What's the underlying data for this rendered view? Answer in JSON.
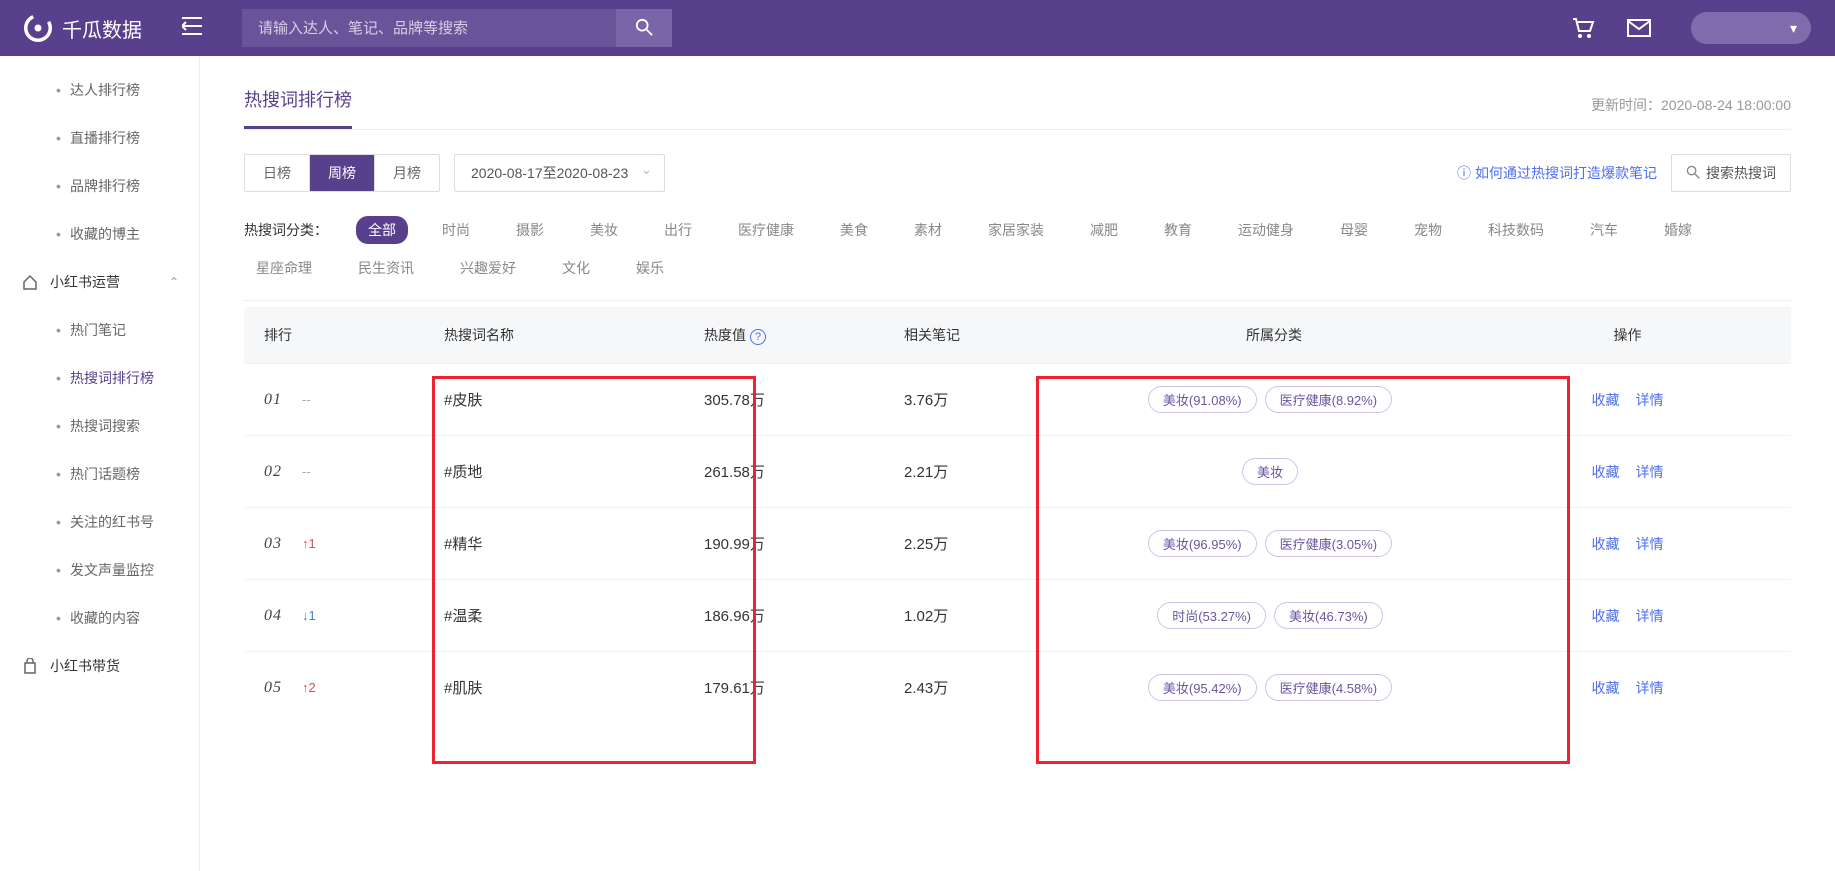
{
  "brand": "千瓜数据",
  "search_placeholder": "请输入达人、笔记、品牌等搜索",
  "sidebar": {
    "top_items": [
      "达人排行榜",
      "直播排行榜",
      "品牌排行榜",
      "收藏的博主"
    ],
    "group1": {
      "label": "小红书运营",
      "expanded": true
    },
    "sub_items": [
      "热门笔记",
      "热搜词排行榜",
      "热搜词搜索",
      "热门话题榜",
      "关注的红书号",
      "发文声量监控",
      "收藏的内容"
    ],
    "active_sub": "热搜词排行榜",
    "group2": {
      "label": "小红书带货"
    }
  },
  "page": {
    "title": "热搜词排行榜",
    "update_label": "更新时间：",
    "update_time": "2020-08-24 18:00:00"
  },
  "segments": {
    "items": [
      "日榜",
      "周榜",
      "月榜"
    ],
    "active": "周榜"
  },
  "date_range": "2020-08-17至2020-08-23",
  "help_link": "如何通过热搜词打造爆款笔记",
  "mini_search_label": "搜索热搜词",
  "categories": {
    "label": "热搜词分类：",
    "active": "全部",
    "items": [
      "全部",
      "时尚",
      "摄影",
      "美妆",
      "出行",
      "医疗健康",
      "美食",
      "素材",
      "家居家装",
      "减肥",
      "教育",
      "运动健身",
      "母婴",
      "宠物",
      "科技数码",
      "汽车",
      "婚嫁",
      "星座命理",
      "民生资讯",
      "兴趣爱好",
      "文化",
      "娱乐"
    ]
  },
  "table": {
    "headers": {
      "rank": "排行",
      "name": "热搜词名称",
      "heat": "热度值",
      "notes": "相关笔记",
      "cat": "所属分类",
      "op": "操作"
    },
    "op_labels": {
      "fav": "收藏",
      "detail": "详情"
    },
    "rows": [
      {
        "rank": "01",
        "trend": "--",
        "trend_dir": "flat",
        "name": "#皮肤",
        "heat": "305.78万",
        "notes": "3.76万",
        "cats": [
          "美妆(91.08%)",
          "医疗健康(8.92%)"
        ]
      },
      {
        "rank": "02",
        "trend": "--",
        "trend_dir": "flat",
        "name": "#质地",
        "heat": "261.58万",
        "notes": "2.21万",
        "cats": [
          "美妆"
        ]
      },
      {
        "rank": "03",
        "trend": "↑1",
        "trend_dir": "up",
        "name": "#精华",
        "heat": "190.99万",
        "notes": "2.25万",
        "cats": [
          "美妆(96.95%)",
          "医疗健康(3.05%)"
        ]
      },
      {
        "rank": "04",
        "trend": "↓1",
        "trend_dir": "down",
        "name": "#温柔",
        "heat": "186.96万",
        "notes": "1.02万",
        "cats": [
          "时尚(53.27%)",
          "美妆(46.73%)"
        ]
      },
      {
        "rank": "05",
        "trend": "↑2",
        "trend_dir": "up",
        "name": "#肌肤",
        "heat": "179.61万",
        "notes": "2.43万",
        "cats": [
          "美妆(95.42%)",
          "医疗健康(4.58%)"
        ]
      }
    ]
  }
}
